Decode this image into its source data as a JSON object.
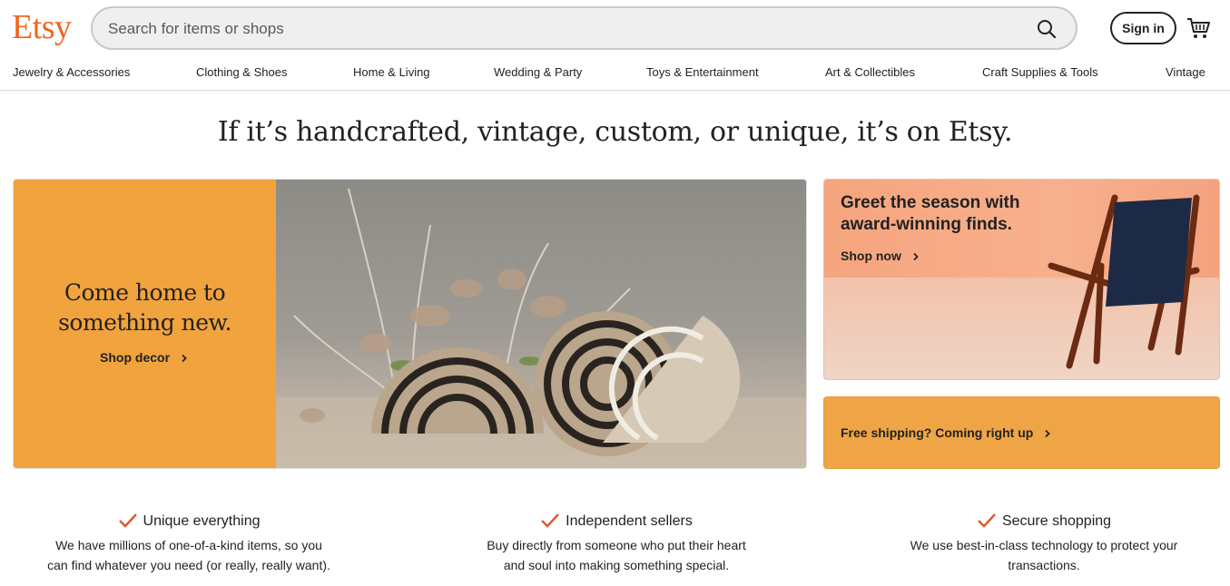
{
  "header": {
    "logo": "Etsy",
    "search_placeholder": "Search for items or shops",
    "sign_in": "Sign in"
  },
  "nav": {
    "items": [
      "Jewelry & Accessories",
      "Clothing & Shoes",
      "Home & Living",
      "Wedding & Party",
      "Toys & Entertainment",
      "Art & Collectibles",
      "Craft Supplies & Tools",
      "Vintage"
    ]
  },
  "headline": "If it’s handcrafted, vintage, custom, or unique, it’s on Etsy.",
  "hero": {
    "title_line1": "Come home to",
    "title_line2": "something new.",
    "link": "Shop decor"
  },
  "promo": {
    "title": "Greet the season with award-winning finds.",
    "link": "Shop now"
  },
  "shipping": {
    "link": "Free shipping? Coming right up"
  },
  "features": [
    {
      "title": "Unique everything",
      "desc_line1": "We have millions of one-of-a-kind items, so you",
      "desc_line2": "can find whatever you need (or really, really want)."
    },
    {
      "title": "Independent sellers",
      "desc_line1": "Buy directly from someone who put their heart",
      "desc_line2": "and soul into making something special."
    },
    {
      "title": "Secure shopping",
      "desc_line1": "We use best-in-class technology to protect your",
      "desc_line2": "transactions."
    }
  ],
  "colors": {
    "brand": "#f1641e",
    "hero_panel": "#f1a33d",
    "shipping_panel": "#efa545",
    "check": "#e0572a"
  },
  "icons": {
    "search": "search-icon",
    "cart": "cart-icon",
    "chevron": "chevron-right-icon",
    "check": "check-icon"
  }
}
